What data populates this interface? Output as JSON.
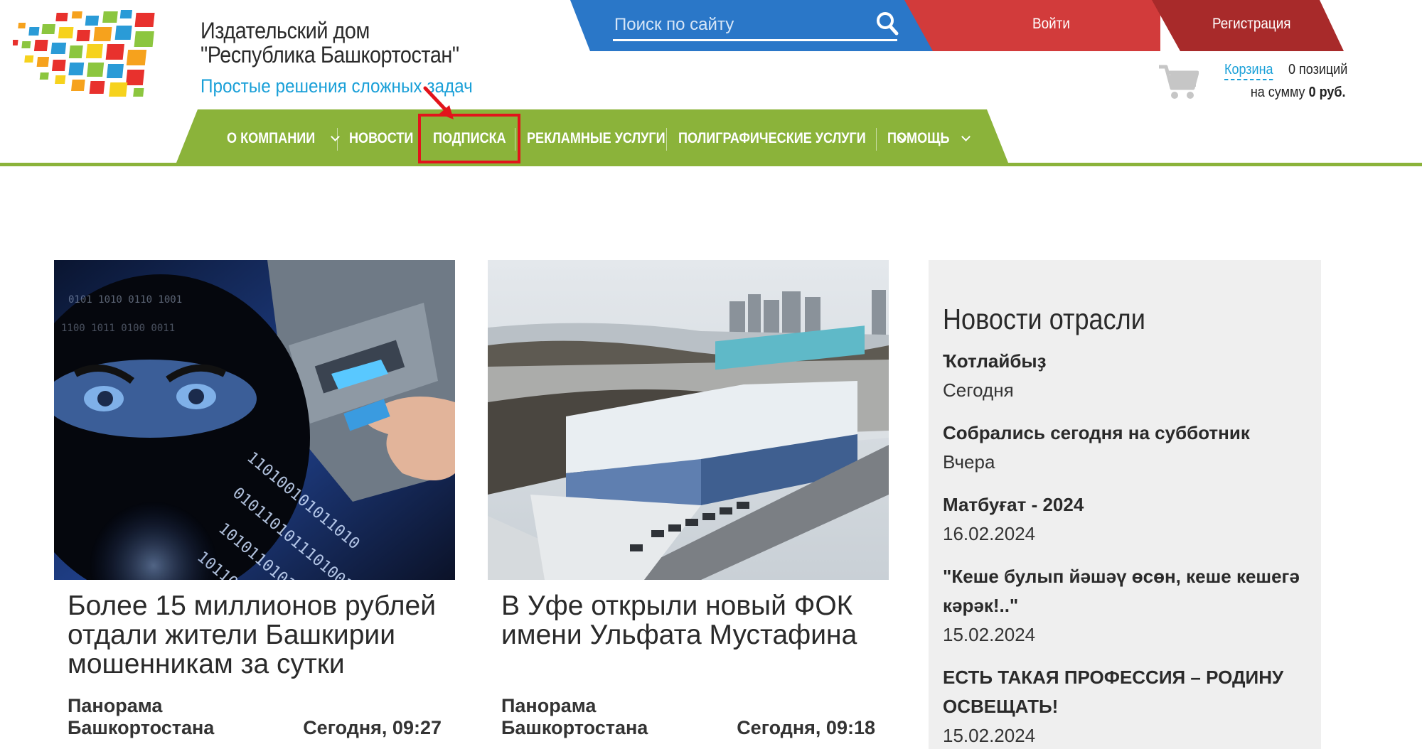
{
  "header": {
    "brand_line1": "Издательский дом",
    "brand_line2": "\"Республика Башкортостан\"",
    "tagline": "Простые решения сложных задач",
    "search_placeholder": "Поиск по сайту",
    "login_label": "Войти",
    "register_label": "Регистрация",
    "cart_label": "Корзина",
    "cart_count": "0 позиций",
    "cart_sum_prefix": "на сумму",
    "cart_sum_value": "0 руб."
  },
  "nav": {
    "items": [
      {
        "label": "О КОМПАНИИ",
        "dropdown": true
      },
      {
        "label": "НОВОСТИ",
        "dropdown": false
      },
      {
        "label": "ПОДПИСКА",
        "dropdown": false,
        "highlighted": true
      },
      {
        "label": "РЕКЛАМНЫЕ УСЛУГИ",
        "dropdown": false
      },
      {
        "label": "ПОЛИГРАФИЧЕСКИЕ УСЛУГИ",
        "dropdown": true
      },
      {
        "label": "ПОМОЩЬ",
        "dropdown": true
      }
    ]
  },
  "cards": [
    {
      "title": "Более 15 миллионов рублей отдали жители Башкирии мошенникам за сутки",
      "source": "Панорама Башкортостана",
      "date": "Сегодня, 09:27"
    },
    {
      "title": "В Уфе открыли новый ФОК имени Ульфата Мустафина",
      "source": "Панорама Башкортостана",
      "date": "Сегодня, 09:18"
    }
  ],
  "sidebar": {
    "title": "Новости отрасли",
    "items": [
      {
        "title": "Ҡотлайбыҙ",
        "date": "Сегодня"
      },
      {
        "title": "Собрались сегодня на субботник",
        "date": "Вчера"
      },
      {
        "title": "Матбуғат - 2024",
        "date": "16.02.2024"
      },
      {
        "title": "\"Кеше булып йәшәү өсөн, кеше кешегә кәрәк!..\"",
        "date": "15.02.2024"
      },
      {
        "title": "ЕСТЬ ТАКАЯ ПРОФЕССИЯ – РОДИНУ ОСВЕЩАТЬ!",
        "date": "15.02.2024"
      }
    ]
  },
  "colors": {
    "nav_green": "#8bb33a",
    "search_blue": "#2a77c8",
    "login_red": "#d23b3b",
    "register_darkred": "#a82a2a",
    "tagline_blue": "#1aa0d8",
    "highlight_red": "#e2141b"
  },
  "icons": [
    "logo-mosaic-icon",
    "search-icon",
    "cart-icon",
    "chevron-down-icon",
    "red-arrow-icon"
  ]
}
